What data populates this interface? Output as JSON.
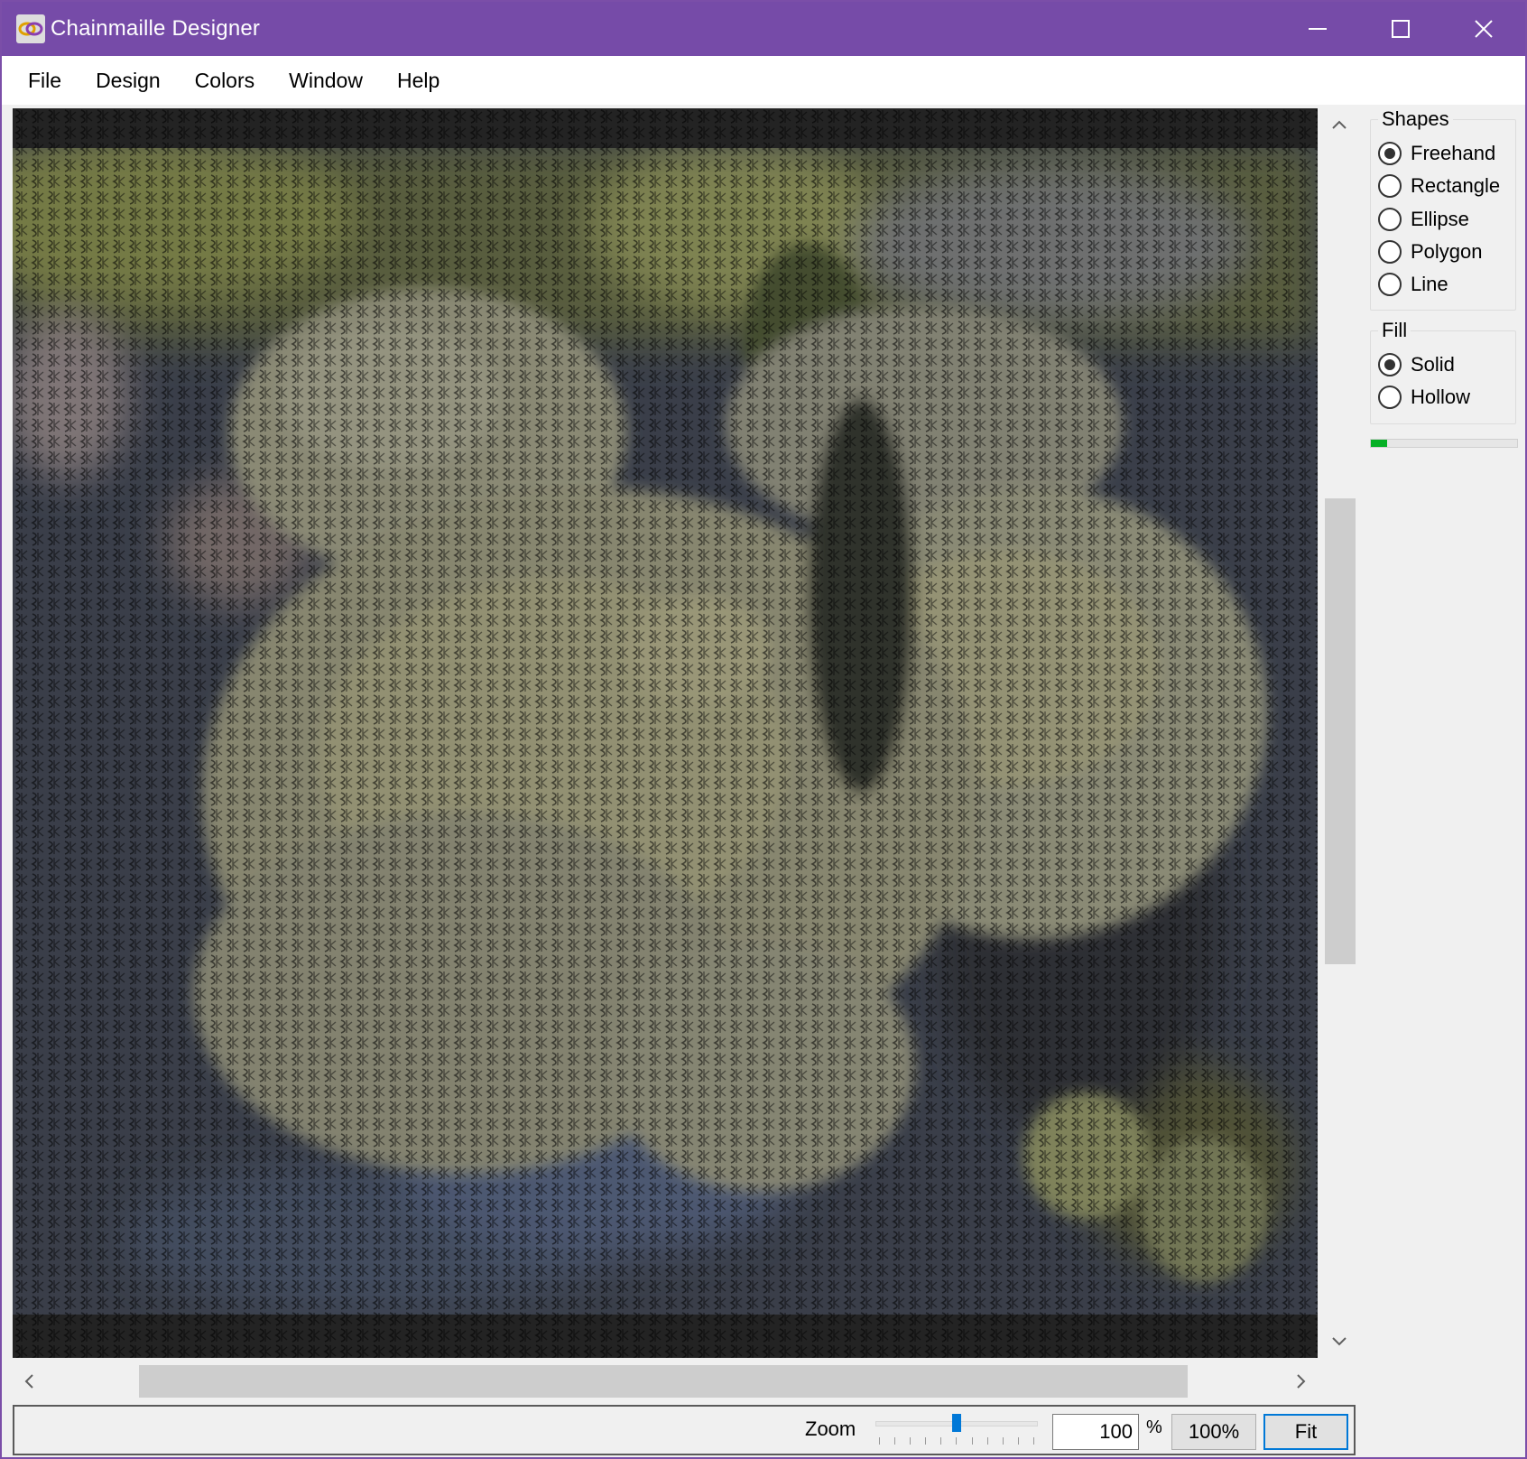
{
  "window": {
    "title": "Chainmaille Designer"
  },
  "window_controls": {
    "minimize": "minimize-icon",
    "maximize": "maximize-icon",
    "close": "close-icon"
  },
  "menu": [
    {
      "label": "File"
    },
    {
      "label": "Design"
    },
    {
      "label": "Colors"
    },
    {
      "label": "Window"
    },
    {
      "label": "Help"
    }
  ],
  "shapes": {
    "title": "Shapes",
    "options": [
      {
        "label": "Freehand",
        "checked": true
      },
      {
        "label": "Rectangle",
        "checked": false
      },
      {
        "label": "Ellipse",
        "checked": false
      },
      {
        "label": "Polygon",
        "checked": false
      },
      {
        "label": "Line",
        "checked": false
      }
    ]
  },
  "fill": {
    "title": "Fill",
    "options": [
      {
        "label": "Solid",
        "checked": true
      },
      {
        "label": "Hollow",
        "checked": false
      }
    ]
  },
  "progress": {
    "value_fraction": 0.11,
    "color": "#06b025"
  },
  "status": {
    "zoom_label": "Zoom",
    "zoom_value": "100",
    "percent_symbol": "%",
    "btn_100": "100%",
    "btn_fit": "Fit",
    "slider_fraction": 0.5
  },
  "colors": {
    "titlebar": "#764ba8",
    "accent": "#0078d7",
    "chainmaille_dark": "#1c1c1c",
    "chainmaille_ring": "#9a9a9a"
  }
}
